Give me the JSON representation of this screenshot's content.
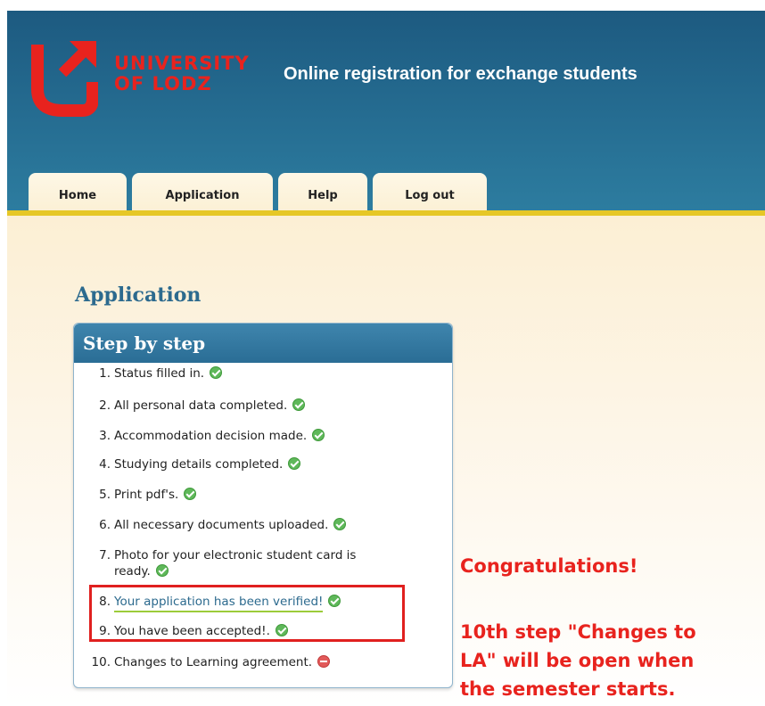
{
  "header": {
    "logo_line1": "UNIVERSITY",
    "logo_line2": "OF LODZ",
    "site_title": "Online registration for exchange students"
  },
  "tabs": [
    {
      "label": "Home"
    },
    {
      "label": "Application"
    },
    {
      "label": "Help"
    },
    {
      "label": "Log out"
    }
  ],
  "page_title": "Application",
  "panel": {
    "title": "Step by step",
    "steps": [
      {
        "num": "1.",
        "text": "Status filled in.",
        "status": "ok"
      },
      {
        "num": "2.",
        "text": "All personal data completed.",
        "status": "ok"
      },
      {
        "num": "3.",
        "text": "Accommodation decision made.",
        "status": "ok"
      },
      {
        "num": "4.",
        "text": "Studying details completed.",
        "status": "ok"
      },
      {
        "num": "5.",
        "text": "Print pdf's.",
        "status": "ok"
      },
      {
        "num": "6.",
        "text": "All necessary documents uploaded.",
        "status": "ok"
      },
      {
        "num": "7.",
        "text": "Photo for your electronic student card is",
        "text_cont": "ready.",
        "status": "ok"
      },
      {
        "num": "8.",
        "text": "Your application has been verified!",
        "status": "ok",
        "link": true
      },
      {
        "num": "9.",
        "text": "You have been accepted!.",
        "status": "ok"
      },
      {
        "num": "10.",
        "text": "Changes to Learning agreement.",
        "status": "blocked"
      }
    ]
  },
  "annotation": {
    "line1": "Congratulations!",
    "line2": "10th step \"Changes to",
    "line3": "LA\" will be open when",
    "line4": "the semester starts."
  },
  "colors": {
    "header_blue": "#246a8f",
    "brand_red": "#e8231e",
    "accent_yellow": "#e6c726",
    "ok_green": "#5fb85a",
    "blocked_red": "#e25a5a"
  }
}
